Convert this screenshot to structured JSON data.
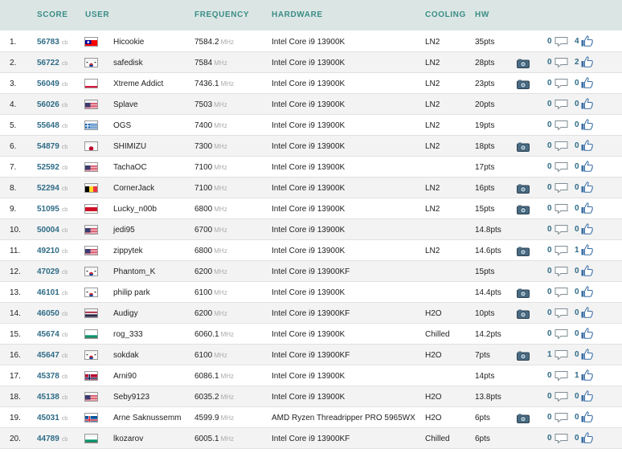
{
  "headers": {
    "score": "SCORE",
    "user": "USER",
    "frequency": "FREQUENCY",
    "hardware": "HARDWARE",
    "cooling": "COOLING",
    "hw": "HW"
  },
  "units": {
    "score": "cb",
    "freq": "MHz"
  },
  "rows": [
    {
      "rank": "1.",
      "score": "56783",
      "flag": "tw",
      "user": "Hicookie",
      "freq": "7584.2",
      "hardware": "Intel Core i9 13900K",
      "cooling": "LN2",
      "pts": "35pts",
      "photo": false,
      "comments": "0",
      "likes": "4"
    },
    {
      "rank": "2.",
      "score": "56722",
      "flag": "kr",
      "user": "safedisk",
      "freq": "7584",
      "hardware": "Intel Core i9 13900K",
      "cooling": "LN2",
      "pts": "28pts",
      "photo": true,
      "comments": "0",
      "likes": "2"
    },
    {
      "rank": "3.",
      "score": "56049",
      "flag": "pl",
      "user": "Xtreme Addict",
      "freq": "7436.1",
      "hardware": "Intel Core i9 13900K",
      "cooling": "LN2",
      "pts": "23pts",
      "photo": true,
      "comments": "0",
      "likes": "0"
    },
    {
      "rank": "4.",
      "score": "56026",
      "flag": "us",
      "user": "Splave",
      "freq": "7503",
      "hardware": "Intel Core i9 13900K",
      "cooling": "LN2",
      "pts": "20pts",
      "photo": false,
      "comments": "0",
      "likes": "0"
    },
    {
      "rank": "5.",
      "score": "55648",
      "flag": "gr",
      "user": "OGS",
      "freq": "7400",
      "hardware": "Intel Core i9 13900K",
      "cooling": "LN2",
      "pts": "19pts",
      "photo": false,
      "comments": "0",
      "likes": "0"
    },
    {
      "rank": "6.",
      "score": "54879",
      "flag": "jp",
      "user": "SHIMIZU",
      "freq": "7300",
      "hardware": "Intel Core i9 13900K",
      "cooling": "LN2",
      "pts": "18pts",
      "photo": true,
      "comments": "0",
      "likes": "0"
    },
    {
      "rank": "7.",
      "score": "52592",
      "flag": "us",
      "user": "TachaOC",
      "freq": "7100",
      "hardware": "Intel Core i9 13900K",
      "cooling": "",
      "pts": "17pts",
      "photo": false,
      "comments": "0",
      "likes": "0"
    },
    {
      "rank": "8.",
      "score": "52294",
      "flag": "be",
      "user": "CornerJack",
      "freq": "7100",
      "hardware": "Intel Core i9 13900K",
      "cooling": "LN2",
      "pts": "16pts",
      "photo": true,
      "comments": "0",
      "likes": "0"
    },
    {
      "rank": "9.",
      "score": "51095",
      "flag": "id",
      "user": "Lucky_n00b",
      "freq": "6800",
      "hardware": "Intel Core i9 13900K",
      "cooling": "LN2",
      "pts": "15pts",
      "photo": true,
      "comments": "0",
      "likes": "0"
    },
    {
      "rank": "10.",
      "score": "50004",
      "flag": "us",
      "user": "jedi95",
      "freq": "6700",
      "hardware": "Intel Core i9 13900K",
      "cooling": "",
      "pts": "14.8pts",
      "photo": false,
      "comments": "0",
      "likes": "0"
    },
    {
      "rank": "11.",
      "score": "49210",
      "flag": "us",
      "user": "zippytek",
      "freq": "6800",
      "hardware": "Intel Core i9 13900K",
      "cooling": "LN2",
      "pts": "14.6pts",
      "photo": true,
      "comments": "0",
      "likes": "1"
    },
    {
      "rank": "12.",
      "score": "47029",
      "flag": "kr",
      "user": "Phantom_K",
      "freq": "6200",
      "hardware": "Intel Core i9 13900KF",
      "cooling": "",
      "pts": "15pts",
      "photo": false,
      "comments": "0",
      "likes": "0"
    },
    {
      "rank": "13.",
      "score": "46101",
      "flag": "kr",
      "user": "philip park",
      "freq": "6100",
      "hardware": "Intel Core i9 13900K",
      "cooling": "",
      "pts": "14.4pts",
      "photo": true,
      "comments": "0",
      "likes": "0"
    },
    {
      "rank": "14.",
      "score": "46050",
      "flag": "th",
      "user": "Audigy",
      "freq": "6200",
      "hardware": "Intel Core i9 13900KF",
      "cooling": "H2O",
      "pts": "10pts",
      "photo": true,
      "comments": "0",
      "likes": "0"
    },
    {
      "rank": "15.",
      "score": "45674",
      "flag": "bg",
      "user": "rog_333",
      "freq": "6060.1",
      "hardware": "Intel Core i9 13900K",
      "cooling": "Chilled",
      "pts": "14.2pts",
      "photo": false,
      "comments": "0",
      "likes": "0"
    },
    {
      "rank": "16.",
      "score": "45647",
      "flag": "kr",
      "user": "sokdak",
      "freq": "6100",
      "hardware": "Intel Core i9 13900KF",
      "cooling": "H2O",
      "pts": "7pts",
      "photo": true,
      "comments": "1",
      "likes": "0"
    },
    {
      "rank": "17.",
      "score": "45378",
      "flag": "no",
      "user": "Arni90",
      "freq": "6086.1",
      "hardware": "Intel Core i9 13900K",
      "cooling": "",
      "pts": "14pts",
      "photo": false,
      "comments": "0",
      "likes": "1"
    },
    {
      "rank": "18.",
      "score": "45138",
      "flag": "us",
      "user": "Seby9123",
      "freq": "6035.2",
      "hardware": "Intel Core i9 13900K",
      "cooling": "H2O",
      "pts": "13.8pts",
      "photo": false,
      "comments": "0",
      "likes": "0"
    },
    {
      "rank": "19.",
      "score": "45031",
      "flag": "is",
      "user": "Arne Saknussemm",
      "freq": "4599.9",
      "hardware": "AMD Ryzen Threadripper PRO 5965WX",
      "cooling": "H2O",
      "pts": "6pts",
      "photo": true,
      "comments": "0",
      "likes": "0"
    },
    {
      "rank": "20.",
      "score": "44789",
      "flag": "bg",
      "user": "lkozarov",
      "freq": "6005.1",
      "hardware": "Intel Core i9 13900KF",
      "cooling": "Chilled",
      "pts": "6pts",
      "photo": false,
      "comments": "0",
      "likes": "0"
    }
  ]
}
